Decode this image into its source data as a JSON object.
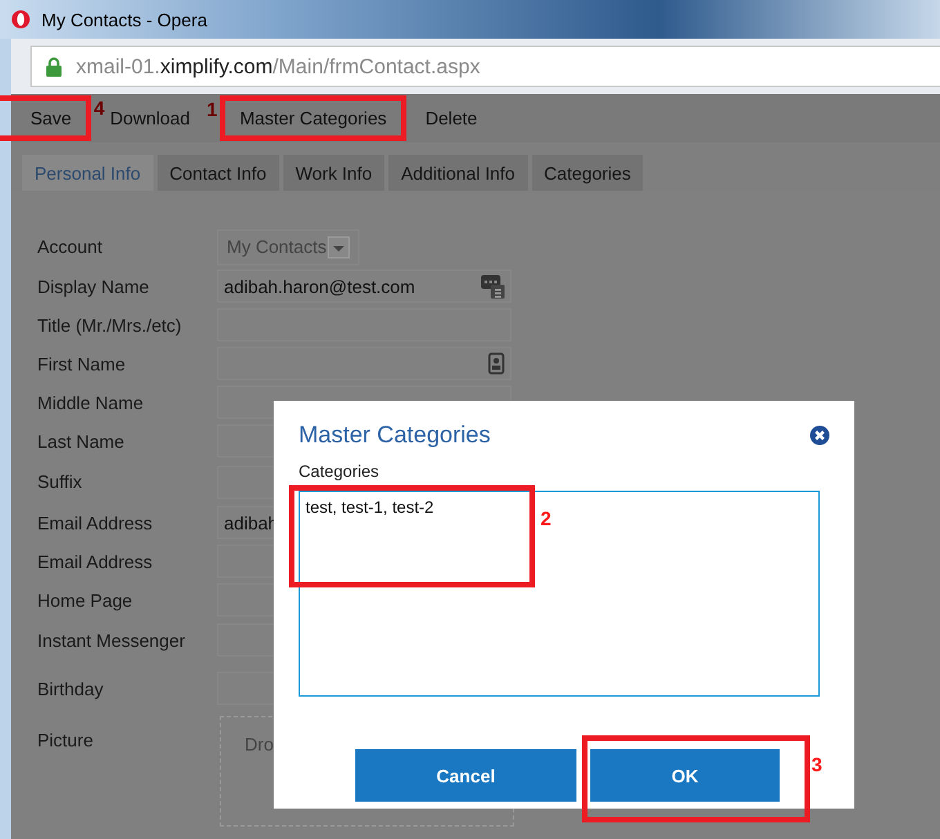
{
  "window": {
    "title": "My Contacts - Opera"
  },
  "address_bar": {
    "url_prefix": "xmail-01.",
    "url_domain": "ximplify.com",
    "url_path": "/Main/frmContact.aspx"
  },
  "toolbar": [
    {
      "label": "Save",
      "annotation": "4"
    },
    {
      "label": "Download"
    },
    {
      "label": "Master Categories",
      "annotation": "1"
    },
    {
      "label": "Delete"
    }
  ],
  "tabs": [
    {
      "label": "Personal Info",
      "selected": true
    },
    {
      "label": "Contact Info",
      "selected": false
    },
    {
      "label": "Work Info",
      "selected": false
    },
    {
      "label": "Additional Info",
      "selected": false
    },
    {
      "label": "Categories",
      "selected": false
    }
  ],
  "form": [
    {
      "label": "Account",
      "kind": "select",
      "value": "My Contacts"
    },
    {
      "label": "Display Name",
      "kind": "text",
      "value": "adibah.haron@test.com"
    },
    {
      "label": "Title (Mr./Mrs./etc)",
      "kind": "text"
    },
    {
      "label": "First Name",
      "kind": "text"
    },
    {
      "label": "Middle Name",
      "kind": "text"
    },
    {
      "label": "Last Name",
      "kind": "text"
    },
    {
      "label": "Suffix",
      "kind": "text"
    },
    {
      "label": "Email Address",
      "kind": "text",
      "value": "adibah"
    },
    {
      "label": "Email Address",
      "kind": "text"
    },
    {
      "label": "Home Page",
      "kind": "text"
    },
    {
      "label": "Instant Messenger",
      "kind": "text"
    },
    {
      "label": "Birthday",
      "kind": "text"
    },
    {
      "label": "Picture",
      "kind": "dropzone",
      "value": "Dro"
    }
  ],
  "dialog": {
    "title": "Master Categories",
    "field_label": "Categories",
    "value": "test, test-1, test-2",
    "value_annotation": "2",
    "buttons": [
      {
        "label": "Cancel"
      },
      {
        "label": "OK",
        "annotation": "3"
      }
    ]
  }
}
